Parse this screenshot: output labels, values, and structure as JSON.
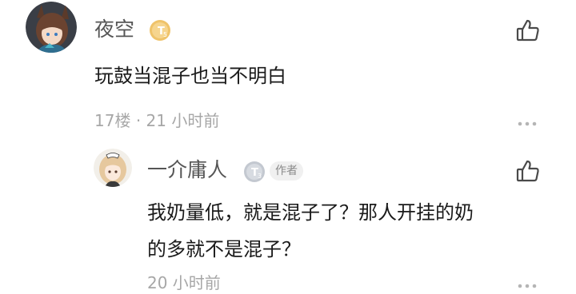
{
  "comment": {
    "username": "夜空",
    "level_badge": "T5",
    "text": "玩鼓当混子也当不明白",
    "floor": "17楼",
    "separator": "·",
    "time": "21 小时前",
    "like_icon": "thumbs-up-icon",
    "more_icon": "more-dots-icon"
  },
  "reply": {
    "username": "一介庸人",
    "level_badge": "T3",
    "author_tag": "作者",
    "text_line1": "我奶量低，就是混子了？那人开挂的奶",
    "text_line2": "的多就不是混子？",
    "time": "20 小时前",
    "like_icon": "thumbs-up-icon",
    "more_icon": "more-dots-icon"
  },
  "colors": {
    "username": "#555555",
    "text": "#1a1a1a",
    "meta": "#a7a7a7",
    "badge_gold": "#e8b84f",
    "badge_silver": "#b8bdc6"
  }
}
